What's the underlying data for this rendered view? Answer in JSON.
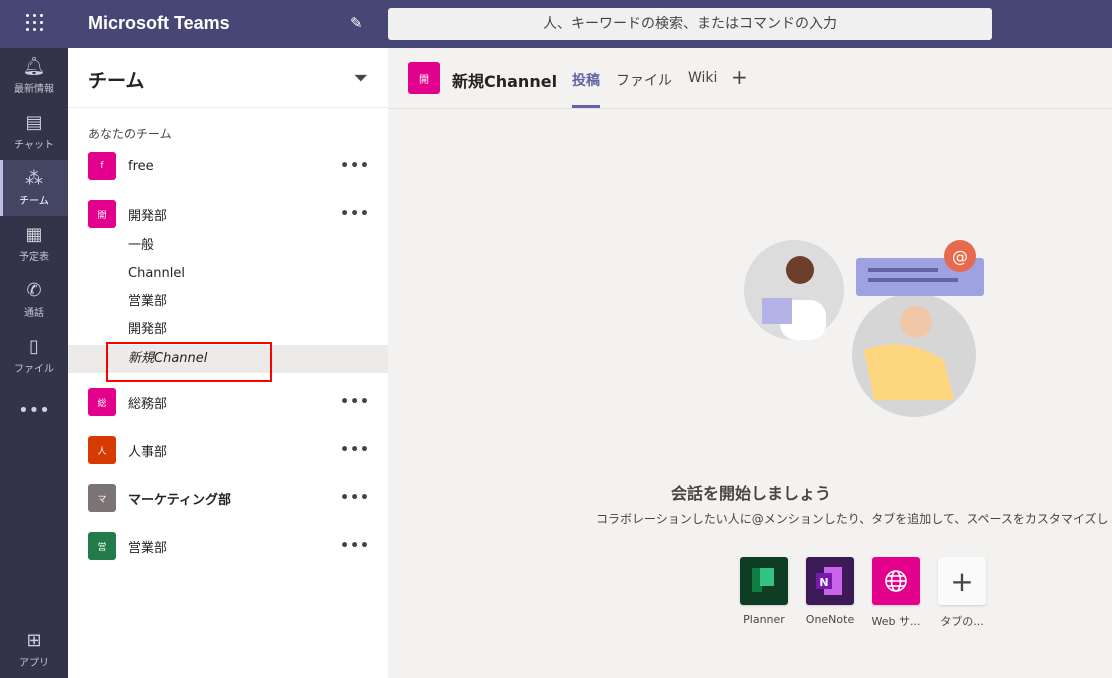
{
  "app": {
    "title": "Microsoft Teams",
    "search_placeholder": "人、キーワードの検索、またはコマンドの入力"
  },
  "rail": [
    {
      "label": "最新情報",
      "icon": "bell-icon"
    },
    {
      "label": "チャット",
      "icon": "chat-icon"
    },
    {
      "label": "チーム",
      "icon": "teams-icon",
      "active": true
    },
    {
      "label": "予定表",
      "icon": "calendar-icon"
    },
    {
      "label": "通話",
      "icon": "phone-icon"
    },
    {
      "label": "ファイル",
      "icon": "file-icon"
    }
  ],
  "rail_more": "•••",
  "rail_apps": "アプリ",
  "panel": {
    "title": "チーム",
    "section": "あなたのチーム",
    "teams": [
      {
        "name": "free",
        "initial": "f",
        "color": "#e3008c"
      },
      {
        "name": "開発部",
        "initial": "開",
        "color": "#e3008c"
      },
      {
        "name": "総務部",
        "initial": "総",
        "color": "#e3008c"
      },
      {
        "name": "人事部",
        "initial": "人",
        "color": "#d83b01"
      },
      {
        "name": "マーケティング部",
        "initial": "マ",
        "color": "#7a7574"
      },
      {
        "name": "営業部",
        "initial": "営",
        "color": "#237b4b"
      }
    ],
    "channels": [
      "一般",
      "Channlel",
      "営業部",
      "開発部",
      "新規Channel"
    ],
    "more": "•••"
  },
  "main": {
    "channel_initial": "開",
    "channel_name": "新規Channel",
    "tabs": [
      "投稿",
      "ファイル",
      "Wiki"
    ],
    "add_tab": "+",
    "heading": "会話を開始しましょう",
    "description": "コラボレーションしたい人に@メンションしたり、タブを追加して、スペースをカスタマイズし",
    "apps": [
      {
        "label": "Planner",
        "color": "#0f3d24"
      },
      {
        "label": "OneNote",
        "color": "#3b1a55"
      },
      {
        "label": "Web サ...",
        "color": "#e3008c"
      },
      {
        "label": "タブの...",
        "color": "#fafafa"
      }
    ]
  }
}
